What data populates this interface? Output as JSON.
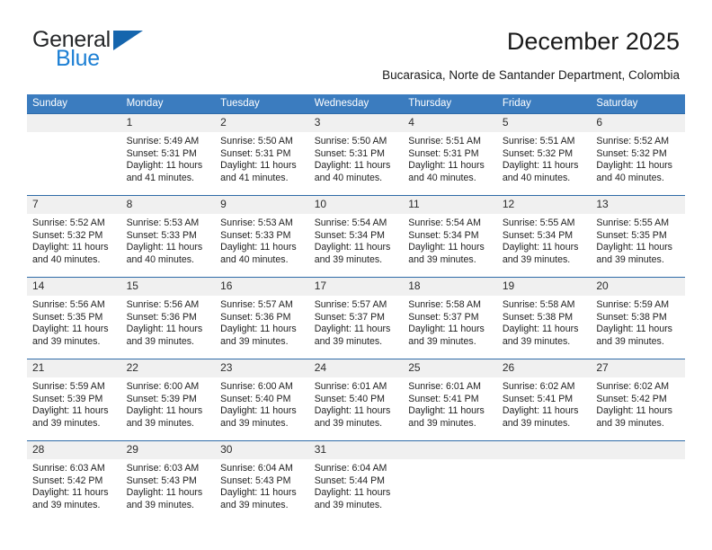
{
  "logo": {
    "word_one": "General",
    "word_two": "Blue",
    "triangle_icon": "triangle-icon"
  },
  "header": {
    "title": "December 2025",
    "subtitle": "Bucarasica, Norte de Santander Department, Colombia"
  },
  "theme": {
    "header_bg": "#3b7cbf",
    "daynum_bg": "#f0f0f0",
    "row_border": "#2f6ba8",
    "logo_blue": "#1c7fd4",
    "logo_dark": "#26282a",
    "triangle_blue": "#1565ad"
  },
  "weekdays": [
    "Sunday",
    "Monday",
    "Tuesday",
    "Wednesday",
    "Thursday",
    "Friday",
    "Saturday"
  ],
  "labels": {
    "sunrise": "Sunrise:",
    "sunset": "Sunset:",
    "daylight": "Daylight:"
  },
  "weeks": [
    [
      {
        "day": "",
        "sunrise": "",
        "sunset": "",
        "daylight_1": "",
        "daylight_2": "",
        "empty": true
      },
      {
        "day": "1",
        "sunrise": "Sunrise: 5:49 AM",
        "sunset": "Sunset: 5:31 PM",
        "daylight_1": "Daylight: 11 hours",
        "daylight_2": "and 41 minutes."
      },
      {
        "day": "2",
        "sunrise": "Sunrise: 5:50 AM",
        "sunset": "Sunset: 5:31 PM",
        "daylight_1": "Daylight: 11 hours",
        "daylight_2": "and 41 minutes."
      },
      {
        "day": "3",
        "sunrise": "Sunrise: 5:50 AM",
        "sunset": "Sunset: 5:31 PM",
        "daylight_1": "Daylight: 11 hours",
        "daylight_2": "and 40 minutes."
      },
      {
        "day": "4",
        "sunrise": "Sunrise: 5:51 AM",
        "sunset": "Sunset: 5:31 PM",
        "daylight_1": "Daylight: 11 hours",
        "daylight_2": "and 40 minutes."
      },
      {
        "day": "5",
        "sunrise": "Sunrise: 5:51 AM",
        "sunset": "Sunset: 5:32 PM",
        "daylight_1": "Daylight: 11 hours",
        "daylight_2": "and 40 minutes."
      },
      {
        "day": "6",
        "sunrise": "Sunrise: 5:52 AM",
        "sunset": "Sunset: 5:32 PM",
        "daylight_1": "Daylight: 11 hours",
        "daylight_2": "and 40 minutes."
      }
    ],
    [
      {
        "day": "7",
        "sunrise": "Sunrise: 5:52 AM",
        "sunset": "Sunset: 5:32 PM",
        "daylight_1": "Daylight: 11 hours",
        "daylight_2": "and 40 minutes."
      },
      {
        "day": "8",
        "sunrise": "Sunrise: 5:53 AM",
        "sunset": "Sunset: 5:33 PM",
        "daylight_1": "Daylight: 11 hours",
        "daylight_2": "and 40 minutes."
      },
      {
        "day": "9",
        "sunrise": "Sunrise: 5:53 AM",
        "sunset": "Sunset: 5:33 PM",
        "daylight_1": "Daylight: 11 hours",
        "daylight_2": "and 40 minutes."
      },
      {
        "day": "10",
        "sunrise": "Sunrise: 5:54 AM",
        "sunset": "Sunset: 5:34 PM",
        "daylight_1": "Daylight: 11 hours",
        "daylight_2": "and 39 minutes."
      },
      {
        "day": "11",
        "sunrise": "Sunrise: 5:54 AM",
        "sunset": "Sunset: 5:34 PM",
        "daylight_1": "Daylight: 11 hours",
        "daylight_2": "and 39 minutes."
      },
      {
        "day": "12",
        "sunrise": "Sunrise: 5:55 AM",
        "sunset": "Sunset: 5:34 PM",
        "daylight_1": "Daylight: 11 hours",
        "daylight_2": "and 39 minutes."
      },
      {
        "day": "13",
        "sunrise": "Sunrise: 5:55 AM",
        "sunset": "Sunset: 5:35 PM",
        "daylight_1": "Daylight: 11 hours",
        "daylight_2": "and 39 minutes."
      }
    ],
    [
      {
        "day": "14",
        "sunrise": "Sunrise: 5:56 AM",
        "sunset": "Sunset: 5:35 PM",
        "daylight_1": "Daylight: 11 hours",
        "daylight_2": "and 39 minutes."
      },
      {
        "day": "15",
        "sunrise": "Sunrise: 5:56 AM",
        "sunset": "Sunset: 5:36 PM",
        "daylight_1": "Daylight: 11 hours",
        "daylight_2": "and 39 minutes."
      },
      {
        "day": "16",
        "sunrise": "Sunrise: 5:57 AM",
        "sunset": "Sunset: 5:36 PM",
        "daylight_1": "Daylight: 11 hours",
        "daylight_2": "and 39 minutes."
      },
      {
        "day": "17",
        "sunrise": "Sunrise: 5:57 AM",
        "sunset": "Sunset: 5:37 PM",
        "daylight_1": "Daylight: 11 hours",
        "daylight_2": "and 39 minutes."
      },
      {
        "day": "18",
        "sunrise": "Sunrise: 5:58 AM",
        "sunset": "Sunset: 5:37 PM",
        "daylight_1": "Daylight: 11 hours",
        "daylight_2": "and 39 minutes."
      },
      {
        "day": "19",
        "sunrise": "Sunrise: 5:58 AM",
        "sunset": "Sunset: 5:38 PM",
        "daylight_1": "Daylight: 11 hours",
        "daylight_2": "and 39 minutes."
      },
      {
        "day": "20",
        "sunrise": "Sunrise: 5:59 AM",
        "sunset": "Sunset: 5:38 PM",
        "daylight_1": "Daylight: 11 hours",
        "daylight_2": "and 39 minutes."
      }
    ],
    [
      {
        "day": "21",
        "sunrise": "Sunrise: 5:59 AM",
        "sunset": "Sunset: 5:39 PM",
        "daylight_1": "Daylight: 11 hours",
        "daylight_2": "and 39 minutes."
      },
      {
        "day": "22",
        "sunrise": "Sunrise: 6:00 AM",
        "sunset": "Sunset: 5:39 PM",
        "daylight_1": "Daylight: 11 hours",
        "daylight_2": "and 39 minutes."
      },
      {
        "day": "23",
        "sunrise": "Sunrise: 6:00 AM",
        "sunset": "Sunset: 5:40 PM",
        "daylight_1": "Daylight: 11 hours",
        "daylight_2": "and 39 minutes."
      },
      {
        "day": "24",
        "sunrise": "Sunrise: 6:01 AM",
        "sunset": "Sunset: 5:40 PM",
        "daylight_1": "Daylight: 11 hours",
        "daylight_2": "and 39 minutes."
      },
      {
        "day": "25",
        "sunrise": "Sunrise: 6:01 AM",
        "sunset": "Sunset: 5:41 PM",
        "daylight_1": "Daylight: 11 hours",
        "daylight_2": "and 39 minutes."
      },
      {
        "day": "26",
        "sunrise": "Sunrise: 6:02 AM",
        "sunset": "Sunset: 5:41 PM",
        "daylight_1": "Daylight: 11 hours",
        "daylight_2": "and 39 minutes."
      },
      {
        "day": "27",
        "sunrise": "Sunrise: 6:02 AM",
        "sunset": "Sunset: 5:42 PM",
        "daylight_1": "Daylight: 11 hours",
        "daylight_2": "and 39 minutes."
      }
    ],
    [
      {
        "day": "28",
        "sunrise": "Sunrise: 6:03 AM",
        "sunset": "Sunset: 5:42 PM",
        "daylight_1": "Daylight: 11 hours",
        "daylight_2": "and 39 minutes."
      },
      {
        "day": "29",
        "sunrise": "Sunrise: 6:03 AM",
        "sunset": "Sunset: 5:43 PM",
        "daylight_1": "Daylight: 11 hours",
        "daylight_2": "and 39 minutes."
      },
      {
        "day": "30",
        "sunrise": "Sunrise: 6:04 AM",
        "sunset": "Sunset: 5:43 PM",
        "daylight_1": "Daylight: 11 hours",
        "daylight_2": "and 39 minutes."
      },
      {
        "day": "31",
        "sunrise": "Sunrise: 6:04 AM",
        "sunset": "Sunset: 5:44 PM",
        "daylight_1": "Daylight: 11 hours",
        "daylight_2": "and 39 minutes."
      },
      {
        "day": "",
        "sunrise": "",
        "sunset": "",
        "daylight_1": "",
        "daylight_2": "",
        "empty": true
      },
      {
        "day": "",
        "sunrise": "",
        "sunset": "",
        "daylight_1": "",
        "daylight_2": "",
        "empty": true
      },
      {
        "day": "",
        "sunrise": "",
        "sunset": "",
        "daylight_1": "",
        "daylight_2": "",
        "empty": true
      }
    ]
  ]
}
